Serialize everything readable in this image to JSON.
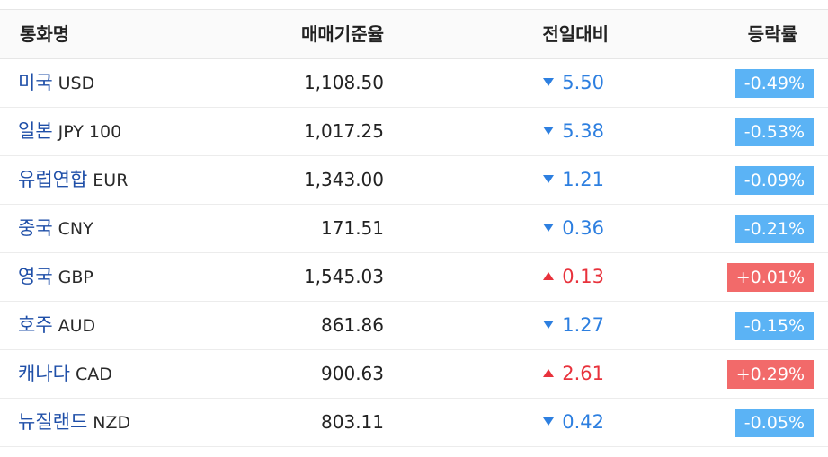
{
  "headers": {
    "name": "통화명",
    "rate": "매매기준율",
    "change": "전일대비",
    "pct": "등락률"
  },
  "colors": {
    "down": "#2d7fe0",
    "up": "#e8323c",
    "badge_down": "#5bb3f5",
    "badge_up": "#f26a6a"
  },
  "rows": [
    {
      "name_kr": "미국",
      "code": "USD",
      "rate": "1,108.50",
      "direction": "down",
      "change": "5.50",
      "pct": "-0.49%"
    },
    {
      "name_kr": "일본",
      "code": "JPY 100",
      "rate": "1,017.25",
      "direction": "down",
      "change": "5.38",
      "pct": "-0.53%"
    },
    {
      "name_kr": "유럽연합",
      "code": "EUR",
      "rate": "1,343.00",
      "direction": "down",
      "change": "1.21",
      "pct": "-0.09%"
    },
    {
      "name_kr": "중국",
      "code": "CNY",
      "rate": "171.51",
      "direction": "down",
      "change": "0.36",
      "pct": "-0.21%"
    },
    {
      "name_kr": "영국",
      "code": "GBP",
      "rate": "1,545.03",
      "direction": "up",
      "change": "0.13",
      "pct": "+0.01%"
    },
    {
      "name_kr": "호주",
      "code": "AUD",
      "rate": "861.86",
      "direction": "down",
      "change": "1.27",
      "pct": "-0.15%"
    },
    {
      "name_kr": "캐나다",
      "code": "CAD",
      "rate": "900.63",
      "direction": "up",
      "change": "2.61",
      "pct": "+0.29%"
    },
    {
      "name_kr": "뉴질랜드",
      "code": "NZD",
      "rate": "803.11",
      "direction": "down",
      "change": "0.42",
      "pct": "-0.05%"
    }
  ]
}
